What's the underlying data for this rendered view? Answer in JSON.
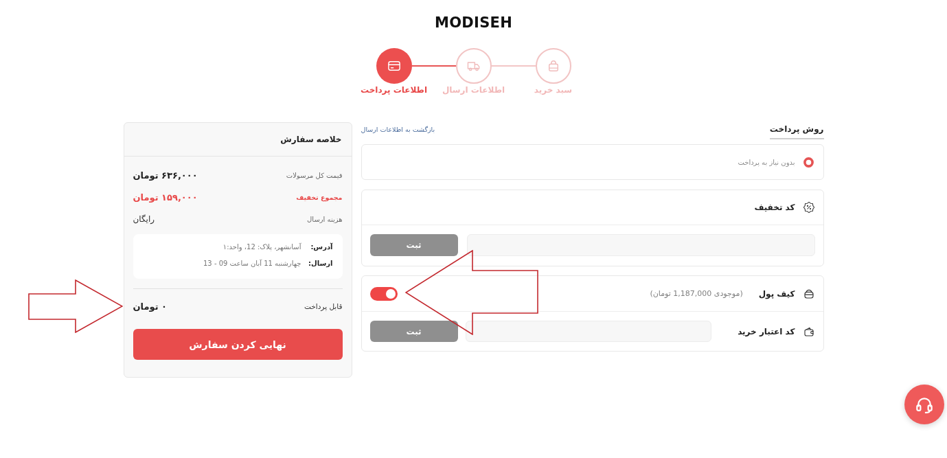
{
  "logo": {
    "text": "MODISEH"
  },
  "steps": [
    {
      "label": "سبد خرید",
      "selected": false
    },
    {
      "label": "اطلاعات ارسال",
      "selected": false
    },
    {
      "label": "اطلاعات پرداخت",
      "selected": true
    }
  ],
  "payment": {
    "title": "روش پرداخت",
    "back_link": "بازگشت به اطلاعات ارسال",
    "methods": [
      {
        "label": "بدون نیاز به پرداخت",
        "selected": true
      }
    ],
    "discount": {
      "title": "کد تخفیف",
      "submit": {
        "label": "ثبت",
        "disabled": true
      }
    },
    "wallet_card": {
      "wallet": {
        "title": "کیف پول",
        "balance": "(موجودی 1,187,000 تومان)",
        "on": true
      },
      "credit_code": {
        "title": "کد اعتبار خرید",
        "submit": {
          "label": "ثبت",
          "disabled": true
        }
      }
    }
  },
  "summary": {
    "title": "خلاصه سفارش",
    "rows": [
      {
        "kind": "amount",
        "label": "قیمت کل مرسولات",
        "value": "۶۳۶,۰۰۰ تومان"
      },
      {
        "kind": "discount",
        "label": "مجموع تخفیف",
        "value": "۱۵۹,۰۰۰ تومان"
      },
      {
        "kind": "plain",
        "label": "هزینه ارسال",
        "value": "رایگان"
      }
    ],
    "details": [
      {
        "label": "آدرس:",
        "value": "آسانشهر، پلاک: 12، واحد:۱"
      },
      {
        "label": "ارسال:",
        "value": "چهارشنبه 11 آبان ساعت 09 - 13"
      }
    ],
    "payable": {
      "label": "قابل پرداخت",
      "value": "۰ تومان"
    },
    "checkout": "نهایی کردن سفارش"
  }
}
